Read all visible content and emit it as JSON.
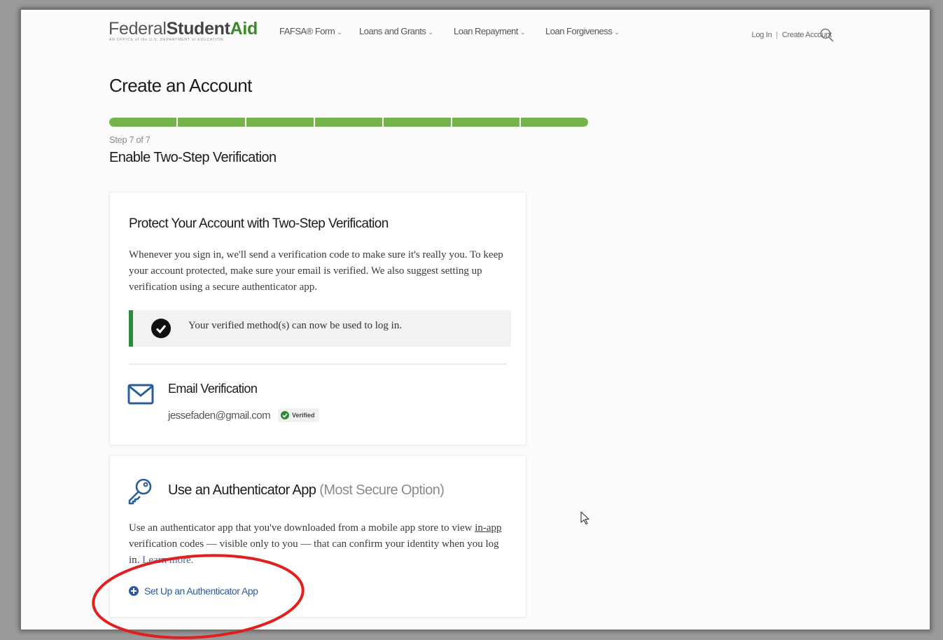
{
  "header": {
    "logo": {
      "part1": "Federal",
      "part2": "Student",
      "part3": "Aid",
      "subtitle": "AN OFFICE of the U.S. DEPARTMENT of EDUCATION"
    },
    "nav": [
      {
        "label": "FAFSA® Form"
      },
      {
        "label": "Loans and Grants"
      },
      {
        "label": "Loan Repayment"
      },
      {
        "label": "Loan Forgiveness"
      }
    ],
    "login_label": "Log In",
    "separator": "|",
    "create_account_label": "Create Account"
  },
  "page": {
    "title": "Create an Account",
    "progress": {
      "current_step": 7,
      "total_steps": 7
    },
    "step_label": "Step 7 of 7",
    "step_title": "Enable Two-Step Verification"
  },
  "protect_card": {
    "heading": "Protect Your Account with Two-Step Verification",
    "description": "Whenever you sign in, we'll send a verification code to make sure it's really you. To keep your account protected, make sure your email is verified. We also suggest setting up verification using a secure authenticator app.",
    "alert_text": "Your verified method(s) can now be used to log in.",
    "email_title": "Email Verification",
    "email_address": "jessefaden@gmail.com",
    "verified_badge": "Verified"
  },
  "auth_card": {
    "title": "Use an Authenticator App",
    "title_suffix": "(Most Secure Option)",
    "desc_part1": "Use an authenticator app that you've downloaded from a mobile app store to view ",
    "desc_underlined": "in-app",
    "desc_part2": " verification codes — visible only to you — that can confirm your identity when you log in. ",
    "learn_more": "Learn more.",
    "setup_link": "Set Up an Authenticator App"
  },
  "colors": {
    "progress_green": "#74b34e",
    "alert_border": "#2e8b3a",
    "link_blue": "#2d5a9e",
    "annotation_red": "#e02020"
  }
}
